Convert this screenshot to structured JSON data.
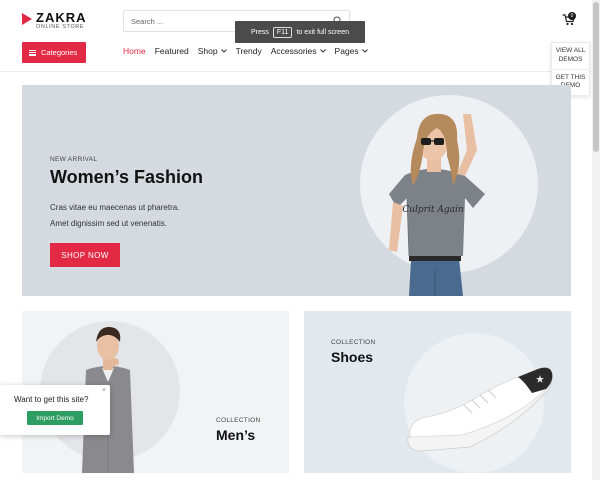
{
  "header": {
    "logo_title": "ZAKRA",
    "logo_subtitle": "ONLINE STORE",
    "search_placeholder": "Search ...",
    "cart_count": "0"
  },
  "f11_toast": {
    "before": "Press",
    "key": "F11",
    "after": "to exit full screen"
  },
  "categories_button": "Categories",
  "nav": [
    {
      "label": "Home",
      "active": true,
      "dropdown": false
    },
    {
      "label": "Featured",
      "active": false,
      "dropdown": false
    },
    {
      "label": "Shop",
      "active": false,
      "dropdown": true
    },
    {
      "label": "Trendy",
      "active": false,
      "dropdown": false
    },
    {
      "label": "Accessories",
      "active": false,
      "dropdown": true
    },
    {
      "label": "Pages",
      "active": false,
      "dropdown": true
    }
  ],
  "demo_panel": {
    "view_all": "VIEW ALL DEMOS",
    "get_this": "GET THIS DEMO"
  },
  "hero": {
    "eyebrow": "NEW ARRIVAL",
    "title": "Women’s Fashion",
    "line1": "Cras vitae eu maecenas ut pharetra.",
    "line2": "Amet dignissim sed ut venenatis.",
    "button": "SHOP NOW",
    "shirt_text": "Culprit Again"
  },
  "men_card": {
    "eyebrow": "COLLECTION",
    "title": "Men’s"
  },
  "shoes_card": {
    "eyebrow": "COLLECTION",
    "title": "Shoes"
  },
  "popup": {
    "text": "Want to get this site?",
    "button": "Import Demo",
    "close": "×"
  },
  "colors": {
    "accent": "#e32a44",
    "import_green": "#2d9d62",
    "hero_bg": "#d5dae0"
  }
}
